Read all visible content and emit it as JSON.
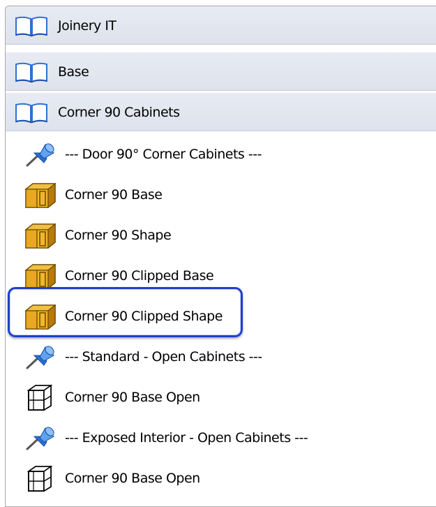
{
  "groups": [
    {
      "label": "Joinery IT",
      "icon": "book-icon"
    },
    {
      "label": "Base",
      "icon": "book-icon"
    },
    {
      "label": "Corner 90 Cabinets",
      "icon": "book-icon"
    }
  ],
  "items": [
    {
      "label": "--- Door 90° Corner Cabinets ---",
      "icon": "pushpin-icon"
    },
    {
      "label": "Corner 90 Base",
      "icon": "door-cabinet-icon"
    },
    {
      "label": "Corner 90 Shape",
      "icon": "door-cabinet-icon"
    },
    {
      "label": "Corner 90 Clipped Base",
      "icon": "door-cabinet-icon"
    },
    {
      "label": "Corner 90 Clipped Shape",
      "icon": "door-cabinet-icon",
      "highlighted": true
    },
    {
      "label": "--- Standard - Open Cabinets ---",
      "icon": "pushpin-icon"
    },
    {
      "label": "Corner 90 Base Open",
      "icon": "open-cabinet-icon"
    },
    {
      "label": "--- Exposed Interior - Open Cabinets ---",
      "icon": "pushpin-icon"
    },
    {
      "label": "Corner 90 Base Open",
      "icon": "open-cabinet-icon"
    }
  ],
  "colors": {
    "header_bg": "#e3e7f0",
    "highlight_border": "#1f3fd0",
    "cabinet_orange": "#e8a820",
    "pin_blue": "#2a6fd6"
  }
}
